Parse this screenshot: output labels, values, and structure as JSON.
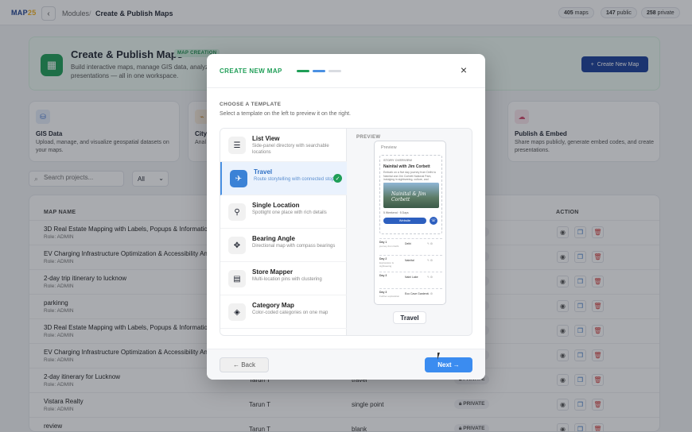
{
  "app": {
    "logo_a": "MAP",
    "logo_b": "25"
  },
  "breadcrumb": {
    "parent": "Modules",
    "current": "Create & Publish Maps"
  },
  "stats": [
    {
      "value": "405",
      "label": "maps"
    },
    {
      "value": "147",
      "label": "public"
    },
    {
      "value": "258",
      "label": "private"
    }
  ],
  "hero": {
    "title": "Create & Publish Maps",
    "badge": "MAP CREATION",
    "description": "Build interactive maps, manage GIS data, analyze presentations — all in one workspace.",
    "create_button": "Create New Map"
  },
  "cards": [
    {
      "title": "GIS Data",
      "description": "Upload, manage, and visualize geospatial datasets on your maps.",
      "icon": "database-icon"
    },
    {
      "title": "City",
      "description": "Anal for c",
      "icon": "chart-icon"
    },
    {
      "title": "Publish & Embed",
      "description": "Share maps publicly, generate embed codes, and create presentations.",
      "icon": "cloud-upload-icon"
    }
  ],
  "search": {
    "placeholder": "Search projects..."
  },
  "filter": {
    "selected": "All"
  },
  "table": {
    "columns": {
      "name": "MAP NAME",
      "action": "ACTION"
    },
    "rows": [
      {
        "name": "3D Real Estate Mapping with Labels, Popups & Information",
        "role": "Role: ADMIN",
        "owner": "",
        "type": "",
        "visibility": "PRIVATE"
      },
      {
        "name": "EV Charging Infrastructure Optimization & Accessibility An",
        "role": "Role: ADMIN",
        "owner": "",
        "type": "",
        "visibility": "PRIVATE"
      },
      {
        "name": "2-day trip itinerary to lucknow",
        "role": "Role: ADMIN",
        "owner": "",
        "type": "",
        "visibility": "PRIVATE"
      },
      {
        "name": "parkinng",
        "role": "Role: ADMIN",
        "owner": "",
        "type": "",
        "visibility": "PRIVATE"
      },
      {
        "name": "3D Real Estate Mapping with Labels, Popups & Information",
        "role": "Role: ADMIN",
        "owner": "",
        "type": "",
        "visibility": "PRIVATE"
      },
      {
        "name": "EV Charging Infrastructure Optimization & Accessibility An",
        "role": "Role: ADMIN",
        "owner": "",
        "type": "",
        "visibility": "PRIVATE"
      },
      {
        "name": "2-day itinerary for Lucknow",
        "role": "Role: ADMIN",
        "owner": "Tarun T",
        "type": "travel",
        "visibility": "PRIVATE"
      },
      {
        "name": "Vistara Realty",
        "role": "Role: ADMIN",
        "owner": "Tarun T",
        "type": "single point",
        "visibility": "PRIVATE"
      },
      {
        "name": "review",
        "role": "Role: ADMIN",
        "owner": "Tarun T",
        "type": "blank",
        "visibility": "PRIVATE"
      }
    ]
  },
  "modal": {
    "title": "CREATE NEW MAP",
    "section_title": "CHOOSE A TEMPLATE",
    "section_subtitle": "Select a template on the left to preview it on the right.",
    "templates": [
      {
        "title": "List View",
        "description": "Side-panel directory with searchable locations",
        "icon": "list-icon",
        "selected": false
      },
      {
        "title": "Travel",
        "description": "Route storytelling with connected stops",
        "icon": "airplane-icon",
        "selected": true
      },
      {
        "title": "Single Location",
        "description": "Spotlight one place with rich details",
        "icon": "pin-icon",
        "selected": false
      },
      {
        "title": "Bearing Angle",
        "description": "Directional map with compass bearings",
        "icon": "compass-icon",
        "selected": false
      },
      {
        "title": "Store Mapper",
        "description": "Multi-location pins with clustering",
        "icon": "store-icon",
        "selected": false
      },
      {
        "title": "Category Map",
        "description": "Color-coded categories on one map",
        "icon": "tag-icon",
        "selected": false
      }
    ],
    "preview": {
      "label": "PREVIEW",
      "phone_header": "Preview",
      "story_label": "STORY OVERVIEW",
      "story_title": "Nainital with Jim Corbett",
      "story_text": "Embark on a five day journey from Delhi to Nainital and Jim Corbett National Park, indulging in sightseeing, culture, and serene...",
      "image_caption": "Nainital & Jim Corbett",
      "meta": "5 Weekend · 5 Days",
      "button": "Website",
      "days": [
        {
          "label": "Day 1",
          "summary": "journey from Delhi",
          "place": "Delhi"
        },
        {
          "label": "Day 2",
          "summary": "Exploration & sightseeing",
          "place": "Nainital"
        },
        {
          "label": "Day 3",
          "summary": "",
          "place": "Naini Lake"
        },
        {
          "label": "Day 3",
          "summary": "Further exploration",
          "place": "Eco Cave Gardens"
        }
      ],
      "template_name": "Travel"
    },
    "back": "← Back",
    "next": "Next →",
    "steps_active": 2,
    "steps_total": 3
  }
}
